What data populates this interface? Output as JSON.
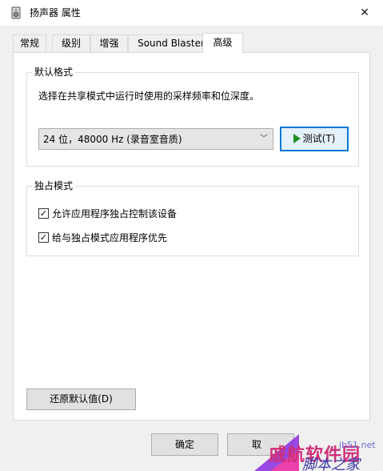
{
  "window": {
    "title": "扬声器 属性",
    "close_glyph": "✕"
  },
  "tabs": [
    {
      "label": "常规"
    },
    {
      "label": "级别"
    },
    {
      "label": "增强"
    },
    {
      "label": "Sound Blaster"
    },
    {
      "label": "高级",
      "active": true
    }
  ],
  "default_format": {
    "group_title": "默认格式",
    "description": "选择在共享模式中运行时使用的采样频率和位深度。",
    "selected_format": "24 位，48000 Hz (录音室音质)",
    "test_button": "测试(T)"
  },
  "exclusive_mode": {
    "group_title": "独占模式",
    "options": [
      {
        "label": "允许应用程序独占控制该设备",
        "checked": true
      },
      {
        "label": "给与独占模式应用程序优先",
        "checked": true
      }
    ]
  },
  "buttons": {
    "restore_defaults": "还原默认值(D)",
    "ok": "确定",
    "cancel_partial": "取"
  },
  "watermark": {
    "line1": "戚航软件园",
    "line2": "脚本之家",
    "line3": "jb51.net"
  },
  "colors": {
    "accent": "#0078d7",
    "play_icon": "#1e8f1e"
  }
}
